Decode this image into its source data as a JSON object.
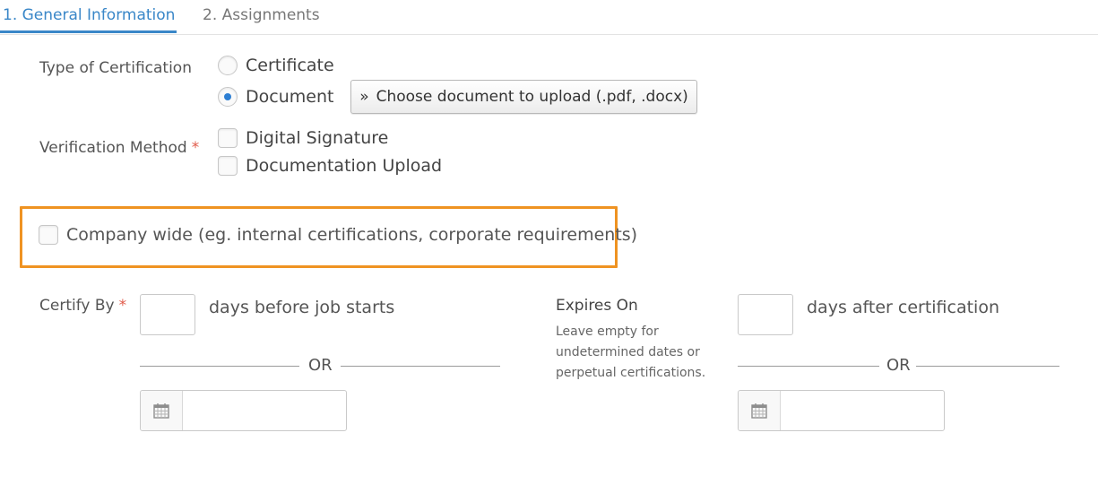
{
  "tabs": [
    {
      "label": "1. General Information",
      "active": true
    },
    {
      "label": "2. Assignments",
      "active": false
    }
  ],
  "type_of_certification": {
    "label": "Type of Certification",
    "options": [
      {
        "label": "Certificate",
        "selected": false
      },
      {
        "label": "Document",
        "selected": true
      }
    ],
    "upload_button": {
      "icon": "double-chevron-right-icon",
      "label": "Choose document to upload (.pdf, .docx)"
    }
  },
  "verification_method": {
    "label": "Verification Method",
    "required_mark": "*",
    "options": [
      {
        "label": "Digital Signature",
        "checked": false
      },
      {
        "label": "Documentation Upload",
        "checked": false
      }
    ]
  },
  "company_wide": {
    "label": "Company wide (eg. internal certifications, corporate requirements)",
    "checked": false,
    "highlight_color": "#ef9322"
  },
  "certify_by": {
    "label": "Certify By",
    "required_mark": "*",
    "days_value": "",
    "days_suffix": "days before job starts",
    "or_label": "OR",
    "date_value": "",
    "date_icon": "calendar-icon"
  },
  "expires_on": {
    "label": "Expires On",
    "help_lines": [
      "Leave empty for",
      "undetermined dates or",
      "perpetual certifications."
    ],
    "days_value": "",
    "days_suffix": "days after certification",
    "or_label": "OR",
    "date_value": "",
    "date_icon": "calendar-icon"
  },
  "colors": {
    "accent": "#3a87c8",
    "required": "#e05a4a",
    "radio_dot": "#2d7fd3"
  }
}
